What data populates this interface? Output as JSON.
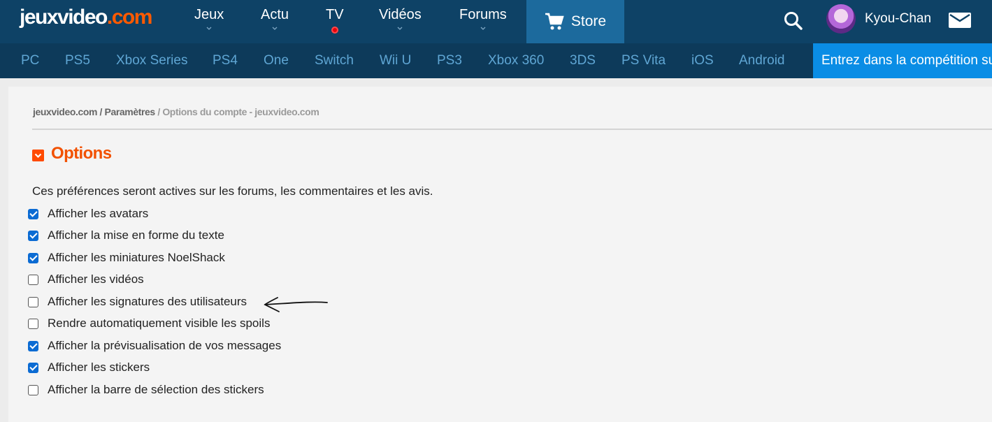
{
  "header": {
    "logo": {
      "part1": "jeuxvideo",
      "dot": ".",
      "part2": "com"
    },
    "nav": [
      {
        "label": "Jeux"
      },
      {
        "label": "Actu"
      },
      {
        "label": "TV"
      },
      {
        "label": "Vidéos"
      },
      {
        "label": "Forums"
      }
    ],
    "store_label": "Store",
    "username": "Kyou-Chan"
  },
  "platforms": [
    "PC",
    "PS5",
    "Xbox Series",
    "PS4",
    "One",
    "Switch",
    "Wii U",
    "PS3",
    "Xbox 360",
    "3DS",
    "PS Vita",
    "iOS",
    "Android"
  ],
  "promo_text": "Entrez dans la compétition sur",
  "breadcrumb": {
    "home": "jeuxvideo.com",
    "sep1": " / ",
    "section": "Paramètres",
    "sep2": " / ",
    "current": "Options du compte - jeuxvideo.com"
  },
  "page_title": "Options",
  "intro": "Ces préférences seront actives sur les forums, les commentaires et les avis.",
  "options": [
    {
      "label": "Afficher les avatars",
      "checked": true
    },
    {
      "label": "Afficher la mise en forme du texte",
      "checked": true
    },
    {
      "label": "Afficher les miniatures NoelShack",
      "checked": true
    },
    {
      "label": "Afficher les vidéos",
      "checked": false
    },
    {
      "label": "Afficher les signatures des utilisateurs",
      "checked": false
    },
    {
      "label": "Rendre automatiquement visible les spoils",
      "checked": false
    },
    {
      "label": "Afficher la prévisualisation de vos messages",
      "checked": true
    },
    {
      "label": "Afficher les stickers",
      "checked": true
    },
    {
      "label": "Afficher la barre de sélection des stickers",
      "checked": false
    }
  ],
  "colors": {
    "header_bg": "#0e4266",
    "platbar_bg": "#0d3a5a",
    "accent_orange": "#f25100",
    "promo_blue": "#0a8de5",
    "checkbox_blue": "#0b6bd3"
  }
}
